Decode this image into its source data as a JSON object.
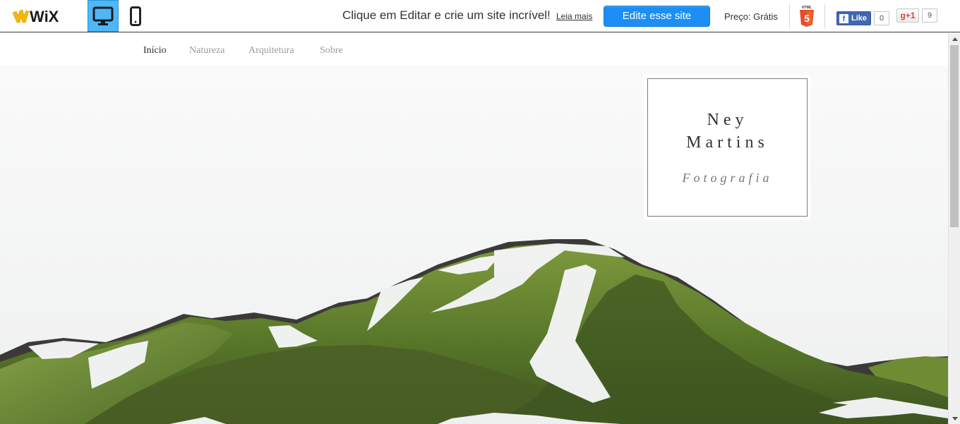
{
  "wixbar": {
    "logo_text": "WiX",
    "devices": [
      {
        "name": "desktop",
        "icon": "desktop-monitor-icon",
        "selected": true
      },
      {
        "name": "mobile",
        "icon": "mobile-phone-icon",
        "selected": false
      }
    ],
    "promo_text": "Clique em Editar e crie um site incrível!",
    "read_more": "Leia mais",
    "edit_button": "Edite esse site",
    "price": "Preço: Grátis",
    "html5_icon": "html5-badge-icon",
    "facebook": {
      "label": "Like",
      "count": "0"
    },
    "gplus": {
      "label": "g+1",
      "count": "9"
    },
    "accent_color": "#1c8ef5"
  },
  "site": {
    "nav": [
      "Início",
      "Natureza",
      "Arquitetura",
      "Sobre"
    ],
    "active_nav": "Início",
    "title_line1": "Ney",
    "title_line2": "Martins",
    "subtitle": "Fotografia",
    "hero_image": "snow-patched green mountain landscape"
  }
}
